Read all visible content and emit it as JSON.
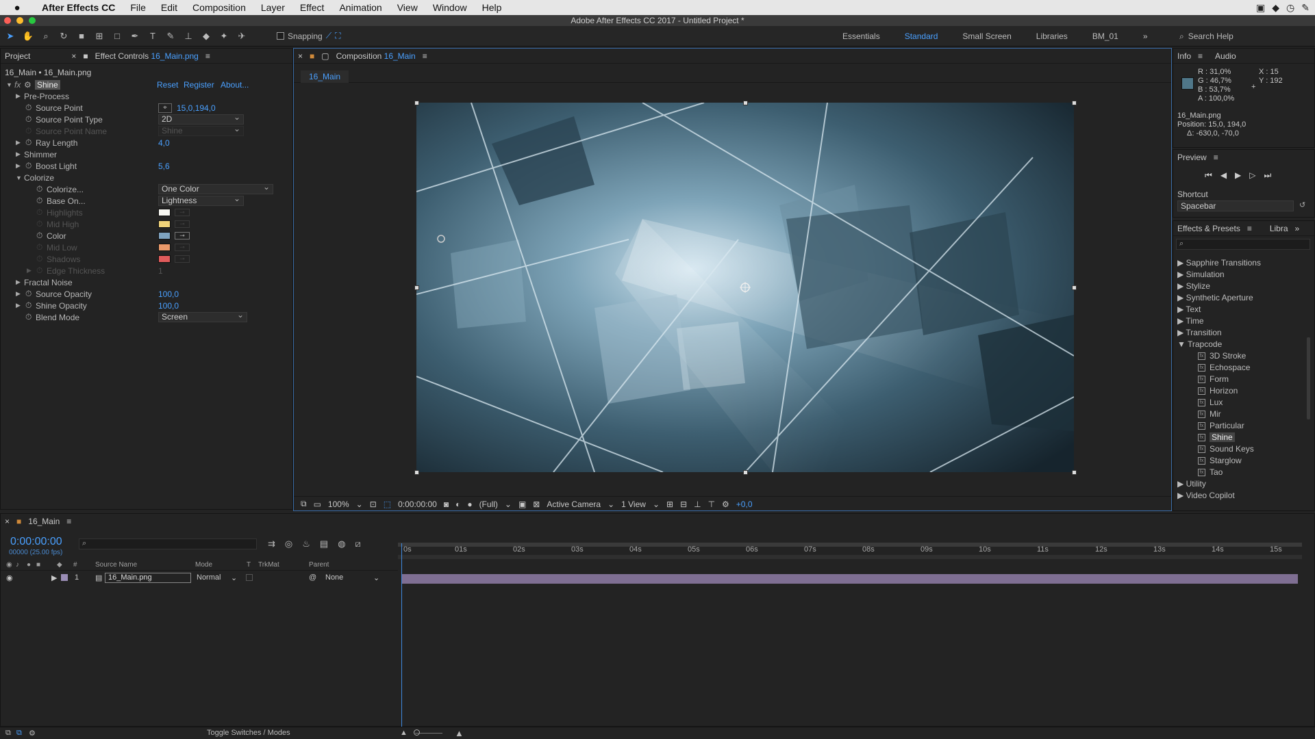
{
  "menubar": {
    "apple": "",
    "app_name": "After Effects CC",
    "items": [
      "File",
      "Edit",
      "Composition",
      "Layer",
      "Effect",
      "Animation",
      "View",
      "Window",
      "Help"
    ]
  },
  "window": {
    "title": "Adobe After Effects CC 2017 - Untitled Project *"
  },
  "toolbar": {
    "snapping_label": "Snapping",
    "workspaces": [
      "Essentials",
      "Standard",
      "Small Screen",
      "Libraries",
      "BM_01"
    ],
    "active_workspace": "Standard",
    "search_placeholder": "Search Help",
    "more": "»"
  },
  "effect_controls": {
    "project_tab": "Project",
    "tab_prefix": "Effect Controls",
    "tab_file": "16_Main.png",
    "breadcrumb": "16_Main • 16_Main.png",
    "effect_name": "Shine",
    "fx_label": "fx",
    "reset": "Reset",
    "register": "Register",
    "about": "About...",
    "rows": {
      "pre_process": "Pre-Process",
      "source_point": "Source Point",
      "source_point_value": "15,0,194,0",
      "source_point_type": "Source Point Type",
      "source_point_type_value": "2D",
      "source_point_name": "Source Point Name",
      "source_point_name_value": "Shine",
      "ray_length": "Ray Length",
      "ray_length_value": "4,0",
      "shimmer": "Shimmer",
      "boost_light": "Boost Light",
      "boost_light_value": "5,6",
      "colorize_group": "Colorize",
      "colorize": "Colorize...",
      "colorize_value": "One Color",
      "base_on": "Base On...",
      "base_on_value": "Lightness",
      "highlights": "Highlights",
      "mid_high": "Mid High",
      "color": "Color",
      "mid_low": "Mid Low",
      "shadows": "Shadows",
      "edge_thickness": "Edge Thickness",
      "edge_thickness_value": "1",
      "fractal_noise": "Fractal Noise",
      "source_opacity": "Source Opacity",
      "source_opacity_value": "100,0",
      "shine_opacity": "Shine Opacity",
      "shine_opacity_value": "100,0",
      "blend_mode": "Blend Mode",
      "blend_mode_value": "Screen"
    },
    "colors": {
      "highlights": "#f7f7f2",
      "mid_high": "#f0d37a",
      "color": "#7fa3bf",
      "mid_low": "#eb9a6a",
      "shadows": "#e05b5b"
    }
  },
  "composition": {
    "tab_prefix": "Composition",
    "tab_name": "16_Main",
    "view_tab": "16_Main",
    "footer": {
      "zoom": "100%",
      "timecode": "0:00:00:00",
      "resolution": "(Full)",
      "camera": "Active Camera",
      "views": "1 View",
      "exposure": "+0,0"
    }
  },
  "info": {
    "tab": "Info",
    "audio_tab": "Audio",
    "r": "R : 31,0%",
    "g": "G : 46,7%",
    "b": "B : 53,7%",
    "a": "A : 100,0%",
    "x": "X : 15",
    "y": "Y : 192",
    "sample_color": "#4f7789",
    "file": "16_Main.png",
    "position": "Position: 15,0, 194,0",
    "delta": "Δ: -630,0, -70,0"
  },
  "preview": {
    "tab": "Preview",
    "shortcut_label": "Shortcut",
    "shortcut_value": "Spacebar"
  },
  "effects_presets": {
    "tab": "Effects & Presets",
    "libraries_tab": "Libra",
    "categories": [
      "Sapphire Transitions",
      "Simulation",
      "Stylize",
      "Synthetic Aperture",
      "Text",
      "Time",
      "Transition"
    ],
    "open_category": "Trapcode",
    "trapcode_items": [
      "3D Stroke",
      "Echospace",
      "Form",
      "Horizon",
      "Lux",
      "Mir",
      "Particular",
      "Shine",
      "Sound Keys",
      "Starglow",
      "Tao"
    ],
    "selected": "Shine",
    "after": [
      "Utility",
      "Video Copilot"
    ]
  },
  "timeline": {
    "tab": "16_Main",
    "timecode": "0:00:00:00",
    "frame_info": "00000 (25.00 fps)",
    "columns": {
      "source_name": "Source Name",
      "mode": "Mode",
      "t": "T",
      "trkmat": "TrkMat",
      "parent": "Parent",
      "hash": "#"
    },
    "layer": {
      "number": "1",
      "name": "16_Main.png",
      "mode": "Normal",
      "parent": "None"
    },
    "ticks": [
      "0s",
      "01s",
      "02s",
      "03s",
      "04s",
      "05s",
      "06s",
      "07s",
      "08s",
      "09s",
      "10s",
      "11s",
      "12s",
      "13s",
      "14s",
      "15s"
    ],
    "toggle_label": "Toggle Switches / Modes"
  }
}
